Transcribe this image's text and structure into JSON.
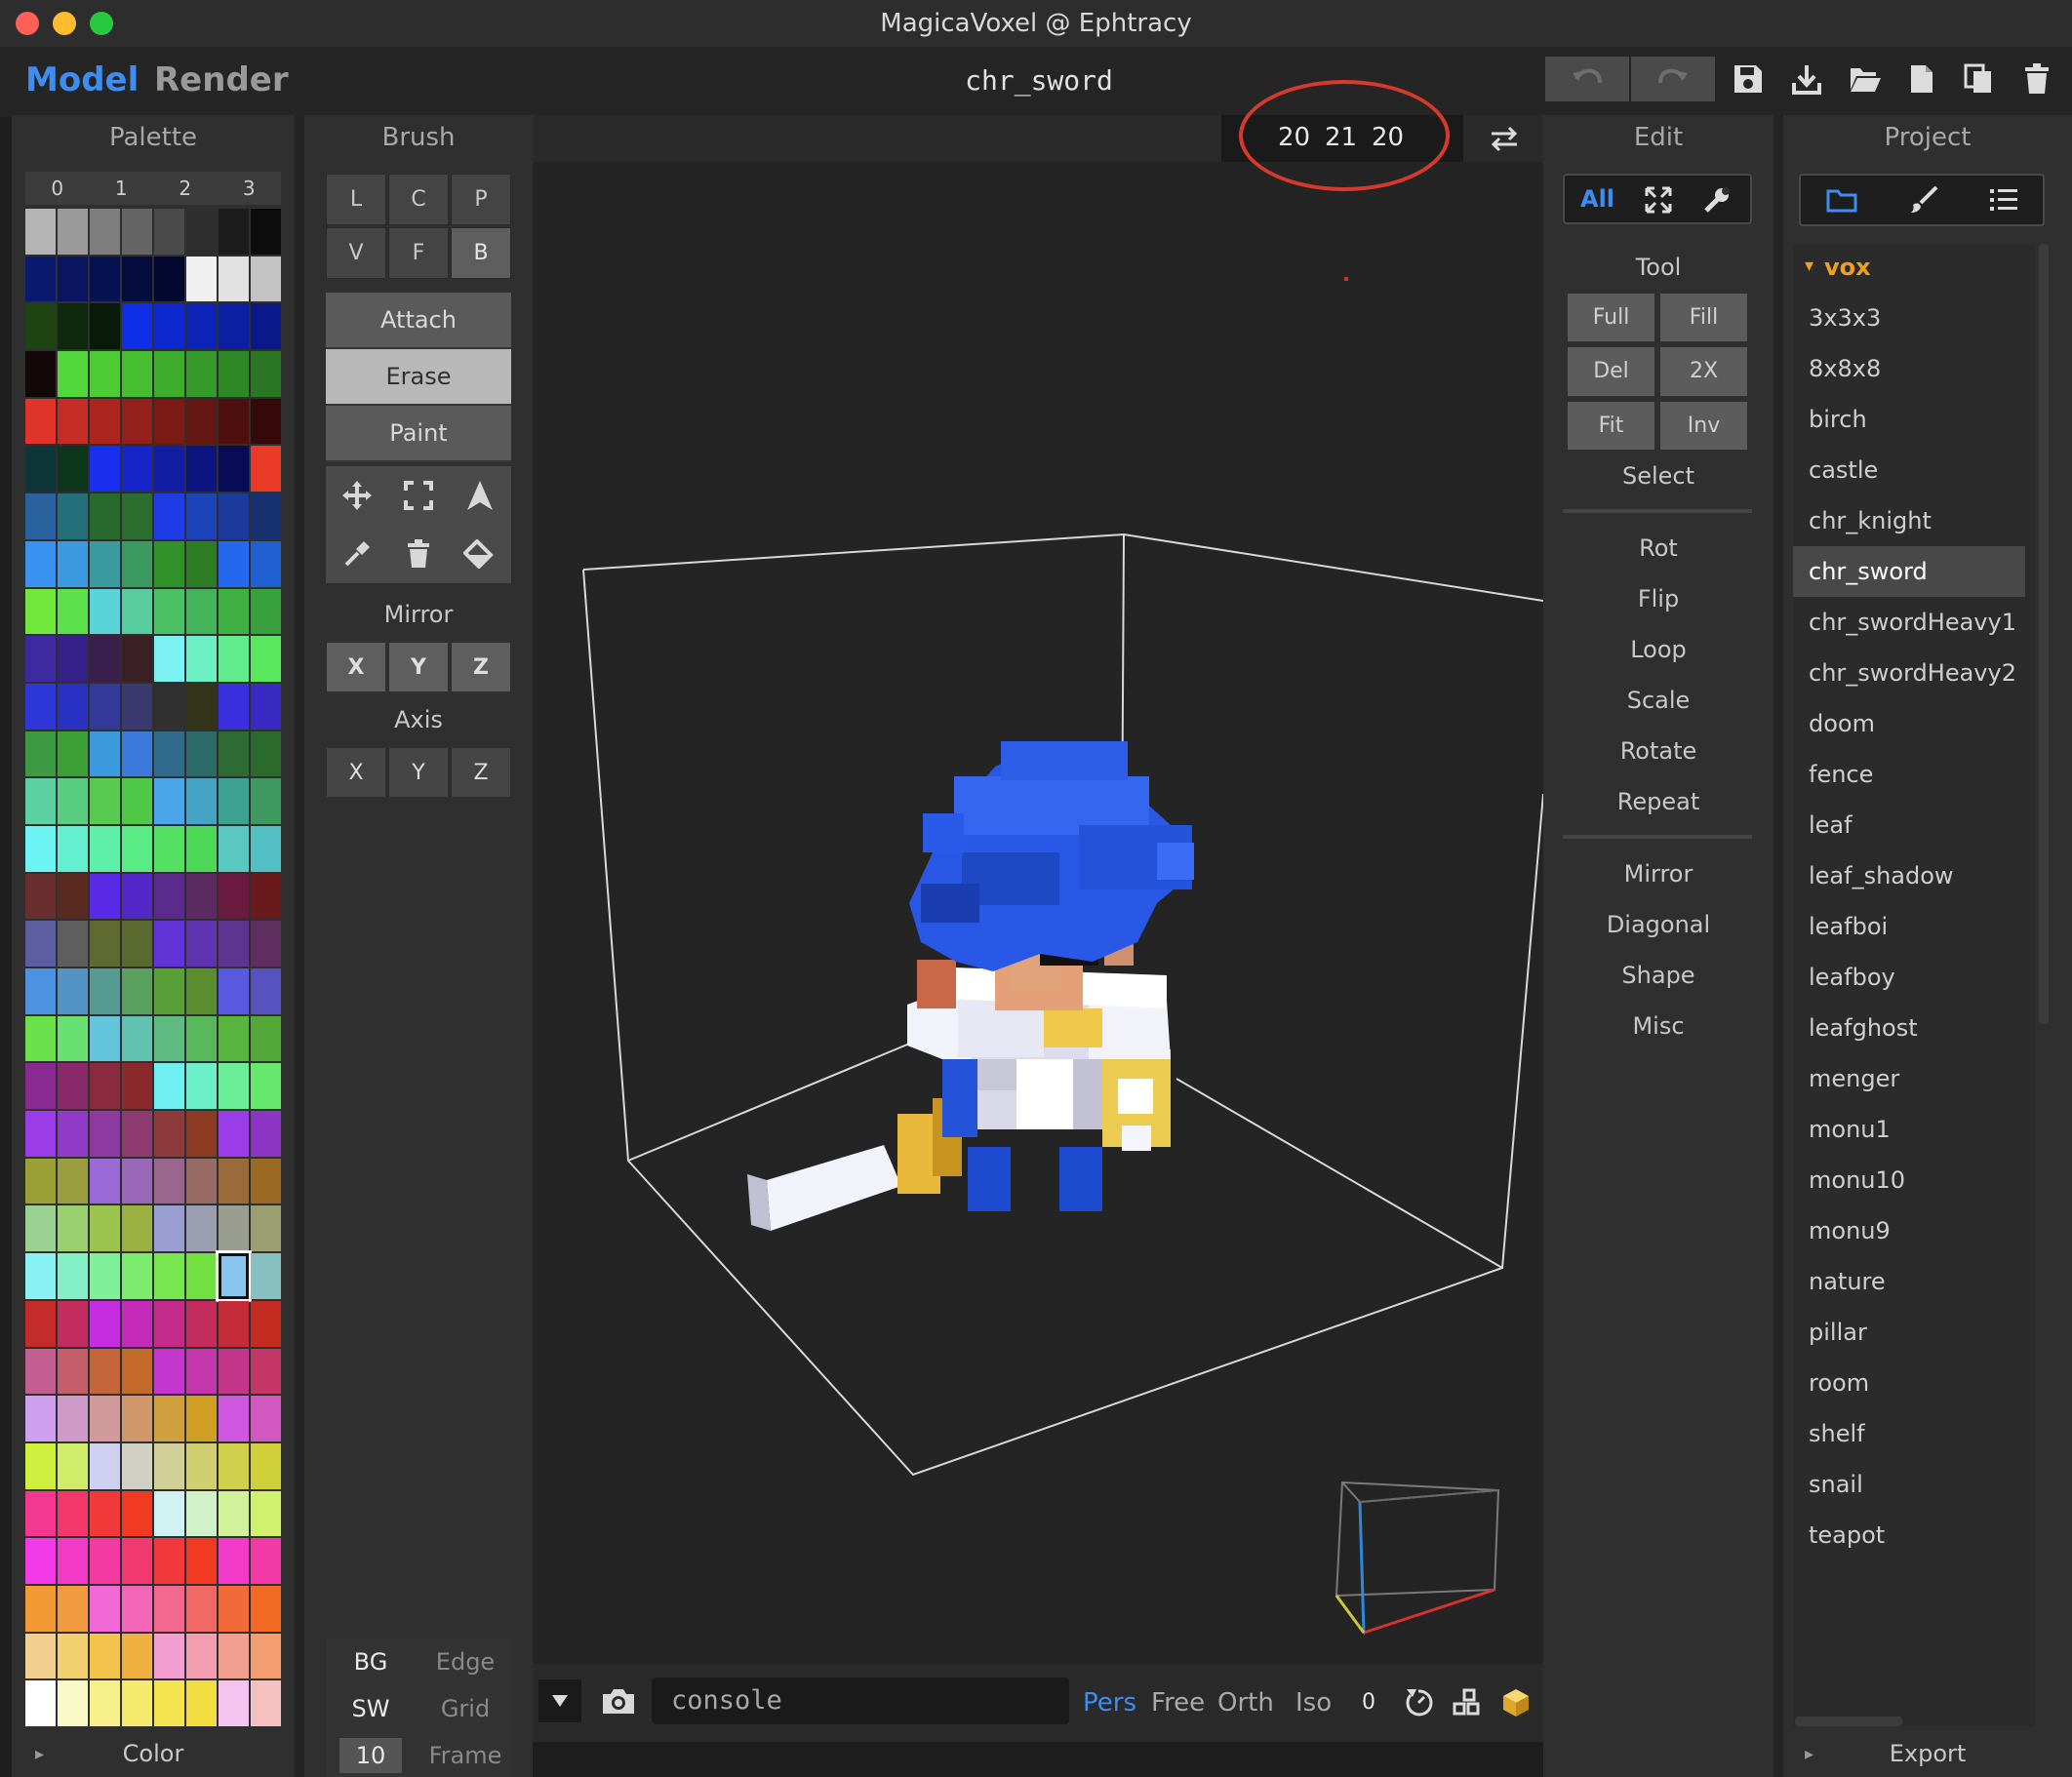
{
  "window": {
    "title": "MagicaVoxel @ Ephtracy"
  },
  "modes": {
    "model": "Model",
    "render": "Render"
  },
  "file": {
    "name": "chr_sword"
  },
  "dims": {
    "x": "20",
    "y": "21",
    "z": "20"
  },
  "palette": {
    "title": "Palette",
    "tabs": [
      "0",
      "1",
      "2",
      "3"
    ],
    "footer": "Color",
    "selected_row": 22,
    "selected_col": 6,
    "rows": [
      [
        "#b4b4b4",
        "#9a9a9a",
        "#7e7e7e",
        "#646464",
        "#4a4a4a",
        "#2e2e2e",
        "#1c1c1c",
        "#0c0c0c"
      ],
      [
        "#0a1a6e",
        "#091560",
        "#071252",
        "#050d3f",
        "#030830",
        "#f0f0f0",
        "#e2e2e2",
        "#c4c4c4"
      ],
      [
        "#1e4412",
        "#0e290c",
        "#081a08",
        "#0f2fe6",
        "#0e28d0",
        "#0c23b8",
        "#0b1fa2",
        "#09198a"
      ],
      [
        "#120808",
        "#52d83a",
        "#4dcc36",
        "#45be32",
        "#3ead2e",
        "#369a2a",
        "#2f8826",
        "#2a7622"
      ],
      [
        "#e0332a",
        "#c42c24",
        "#ac261f",
        "#94211b",
        "#7c1b16",
        "#641612",
        "#4e100e",
        "#360a09"
      ],
      [
        "#0e3638",
        "#0e361c",
        "#1a2ef0",
        "#1624c8",
        "#121da4",
        "#0c1480",
        "#080c54",
        "#ea3a28"
      ],
      [
        "#2a62a0",
        "#24707a",
        "#286a2e",
        "#2a6e30",
        "#1e3de6",
        "#1a44b8",
        "#1c3a9c",
        "#163070"
      ],
      [
        "#3a92f0",
        "#3c9ae0",
        "#3a9a9e",
        "#3a9a60",
        "#32922a",
        "#2e7c24",
        "#2468ee",
        "#2060d0"
      ],
      [
        "#72e83e",
        "#5ce04c",
        "#5ad4d8",
        "#58cc9e",
        "#4cc064",
        "#44b45a",
        "#40b044",
        "#38a03c"
      ],
      [
        "#3e2aa0",
        "#36208a",
        "#3a1f4c",
        "#3a1f24",
        "#7cf2f2",
        "#6cf0c4",
        "#62ec8e",
        "#5ae85e"
      ],
      [
        "#2e38d8",
        "#2a32c4",
        "#343a9a",
        "#3a3a70",
        "#303030",
        "#343418",
        "#3a30e0",
        "#3a2ac4"
      ],
      [
        "#3e9a42",
        "#3ca036",
        "#3a9adc",
        "#3a7adc",
        "#326a8e",
        "#2c6a6a",
        "#2e6a34",
        "#2a6a2a"
      ],
      [
        "#5cd2a4",
        "#5ace80",
        "#58ca50",
        "#4ec846",
        "#4aa6e8",
        "#44a2c4",
        "#3ea292",
        "#3e9a5e"
      ],
      [
        "#6cf4f4",
        "#64f0d0",
        "#5ef0a8",
        "#5aec84",
        "#54e062",
        "#4ed858",
        "#58c8c0",
        "#52c0c4"
      ],
      [
        "#6a2e2e",
        "#5a2a20",
        "#5a2ae6",
        "#5428c8",
        "#5a2a8c",
        "#5a2a60",
        "#6a1a3e",
        "#6a1a1a"
      ],
      [
        "#5c5ea0",
        "#5e5e5e",
        "#5e6a32",
        "#5a6a2e",
        "#6234d8",
        "#6034b0",
        "#5e3490",
        "#5e2e5e"
      ],
      [
        "#4e92e2",
        "#5294c4",
        "#569a92",
        "#5aa05e",
        "#5aa038",
        "#5a8e30",
        "#5a5ae0",
        "#5652c0"
      ],
      [
        "#6ae04a",
        "#68e072",
        "#64c4dc",
        "#62c2b0",
        "#5ebc80",
        "#5ab85c",
        "#58b640",
        "#54a83a"
      ],
      [
        "#882a90",
        "#8a2a6a",
        "#8a2a3e",
        "#8a2a2a",
        "#70f0f0",
        "#6cf0c8",
        "#6aee98",
        "#66e86e"
      ],
      [
        "#9a3ce8",
        "#903ac8",
        "#8c3aa0",
        "#8c3a70",
        "#8c3a3c",
        "#8c3a22",
        "#9a3ce8",
        "#8c34c4"
      ],
      [
        "#9aa034",
        "#9a9e40",
        "#9a6ad6",
        "#9a68b6",
        "#9a6690",
        "#9a6a64",
        "#9a6a3a",
        "#9a6a24"
      ],
      [
        "#9ad090",
        "#9ad070",
        "#9ac44e",
        "#9ab040",
        "#9a9ed0",
        "#9a9eb0",
        "#9a9e90",
        "#9a9e70"
      ],
      [
        "#8af2f2",
        "#84f0c8",
        "#80f09a",
        "#7cec6e",
        "#78e650",
        "#72e040",
        "#8ac4f0",
        "#86c0c0"
      ],
      [
        "#c42c2a",
        "#c42c60",
        "#c42ce0",
        "#c42cb8",
        "#c42c8c",
        "#c42c5e",
        "#c42c3a",
        "#c42c22"
      ],
      [
        "#c45e92",
        "#c45e6a",
        "#c4663c",
        "#c46a2a",
        "#c436d0",
        "#c436ac",
        "#c4368a",
        "#c43666"
      ],
      [
        "#d0a0f0",
        "#d09ac8",
        "#d09a9a",
        "#d0986a",
        "#d0a03e",
        "#d0a024",
        "#d058e0",
        "#d058c0"
      ],
      [
        "#d0f040",
        "#d0ec68",
        "#d0d0f0",
        "#d0d0c4",
        "#d0d098",
        "#d0d070",
        "#d0d04e",
        "#d0d03a"
      ],
      [
        "#f23890",
        "#f2386a",
        "#f23a3a",
        "#f23a22",
        "#d0f2f2",
        "#d0f2c8",
        "#d0f29a",
        "#d0f26e"
      ],
      [
        "#f23ae8",
        "#f23ac8",
        "#f23aa0",
        "#f23a70",
        "#f23a3c",
        "#f23a22",
        "#f23ac8",
        "#f23aa6"
      ],
      [
        "#f29a34",
        "#f29a40",
        "#f268d6",
        "#f268b6",
        "#f26890",
        "#f26864",
        "#f26a3a",
        "#f26a24"
      ],
      [
        "#f2d090",
        "#f2d070",
        "#f2c44e",
        "#f2b040",
        "#f29ed0",
        "#f29eb0",
        "#f29e90",
        "#f29e70"
      ],
      [
        "#ffffff",
        "#fafac8",
        "#f8f08a",
        "#f6ea6e",
        "#f4e450",
        "#f2de40",
        "#f6c4f0",
        "#f4c0c0"
      ]
    ]
  },
  "brush": {
    "title": "Brush",
    "types": [
      "L",
      "C",
      "P",
      "V",
      "F",
      "B"
    ],
    "modes": [
      "Attach",
      "Erase",
      "Paint"
    ],
    "mirror_label": "Mirror",
    "axis_label": "Axis",
    "mirror_axes": [
      "X",
      "Y",
      "Z"
    ],
    "axis_axes": [
      "X",
      "Y",
      "Z"
    ]
  },
  "display": {
    "bg": "BG",
    "edge": "Edge",
    "sw": "SW",
    "grid": "Grid",
    "frame_num": "10",
    "frame": "Frame"
  },
  "edit": {
    "title": "Edit",
    "all": "All",
    "tool_label": "Tool",
    "tool_buttons": [
      "Full",
      "Fill",
      "Del",
      "2X",
      "Fit",
      "Inv"
    ],
    "select_label": "Select",
    "group1": [
      "Rot",
      "Flip",
      "Loop",
      "Scale",
      "Rotate",
      "Repeat"
    ],
    "group2": [
      "Mirror",
      "Diagonal",
      "Shape",
      "Misc"
    ]
  },
  "project": {
    "title": "Project",
    "folder": "vox",
    "items": [
      "3x3x3",
      "8x8x8",
      "birch",
      "castle",
      "chr_knight",
      "chr_sword",
      "chr_swordHeavy1",
      "chr_swordHeavy2",
      "doom",
      "fence",
      "leaf",
      "leaf_shadow",
      "leafboi",
      "leafboy",
      "leafghost",
      "menger",
      "monu1",
      "monu10",
      "monu9",
      "nature",
      "pillar",
      "room",
      "shelf",
      "snail",
      "teapot"
    ],
    "selected": "chr_sword",
    "footer": "Export"
  },
  "viewport": {
    "console_placeholder": "console",
    "cam_modes": [
      "Pers",
      "Free",
      "Orth",
      "Iso"
    ],
    "active_cam": "Pers",
    "zoom": "0"
  },
  "colors": {
    "accent_blue": "#3d8ef0",
    "mirror_yellow": "#f1c84b",
    "annotation_red": "#d73a2c",
    "folder_orange": "#f0a020"
  }
}
